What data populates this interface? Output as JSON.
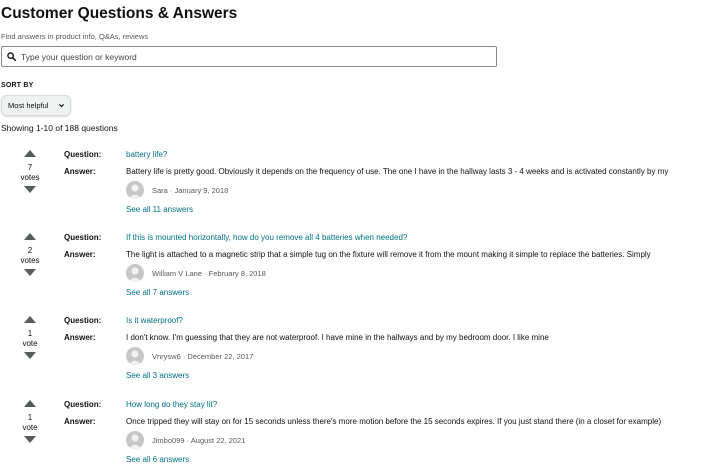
{
  "header": {
    "title": "Customer Questions & Answers",
    "search_hint": "Find answers in product info, Q&As, reviews"
  },
  "search": {
    "placeholder": "Type your question or keyword",
    "icon": "search-icon"
  },
  "sort": {
    "label": "SORT BY",
    "selected": "Most helpful"
  },
  "results": {
    "summary": "Showing 1-10 of 188 questions"
  },
  "labels": {
    "question": "Question:",
    "answer": "Answer:"
  },
  "questions": [
    {
      "votes": "7",
      "vote_word": "votes",
      "question": "battery life?",
      "answer": "Battery life is pretty good. Obviously it depends on the frequency of use. The one I have in the hallway lasts 3 - 4 weeks and is activated constantly by my",
      "byline": "Sara · January 9, 2018",
      "see_all": "See all 11 answers"
    },
    {
      "votes": "2",
      "vote_word": "votes",
      "question": "If this is mounted horizontally, how do you remove all 4 batteries when needed?",
      "answer": "The light is attached to a magnetic strip that a simple tug on the fixture will remove it from the mount making it simple to replace the batteries. Simply",
      "byline": "William V Lane · February 8, 2018",
      "see_all": "See all 7 answers"
    },
    {
      "votes": "1",
      "vote_word": "vote",
      "question": "Is it waterproof?",
      "answer": "I don't know. I'm guessing that they are not waterproof. I have mine in the hallways and by my bedroom door. I like mine",
      "byline": "Vnrysw6 · December 22, 2017",
      "see_all": "See all 3 answers"
    },
    {
      "votes": "1",
      "vote_word": "vote",
      "question": "How long do they stay lit?",
      "answer": "Once tripped they will stay on for 15 seconds unless there's more motion before the 15 seconds expires. If you just stand there (in a closet for example)",
      "byline": "Jimbo099 · August 22, 2021",
      "see_all": "See all 6 answers"
    }
  ],
  "colors": {
    "link": "#007185",
    "text": "#0f1111",
    "muted": "#565959",
    "vote_arrow": "#575b5b"
  }
}
